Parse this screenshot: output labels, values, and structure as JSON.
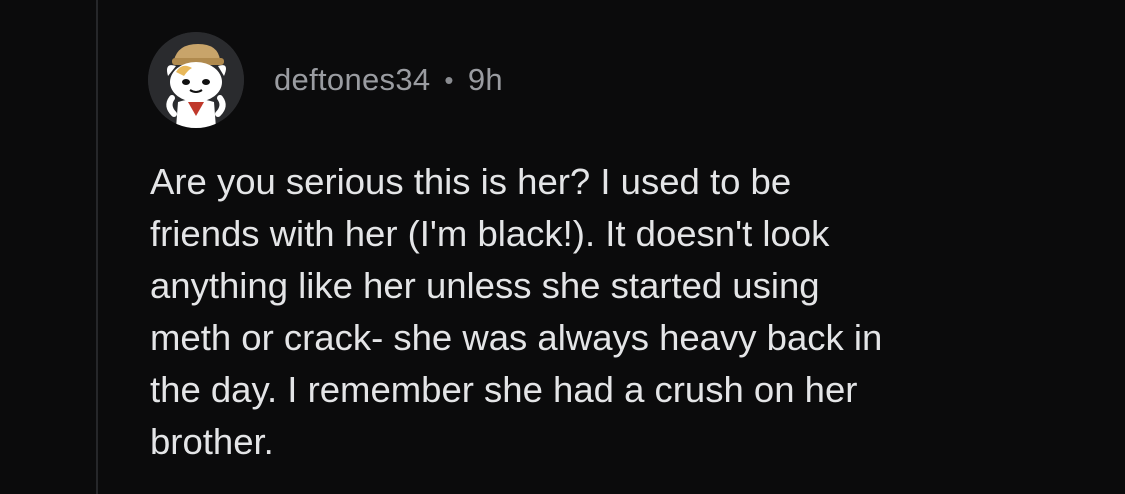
{
  "comment": {
    "username": "deftones34",
    "separator": "•",
    "time": "9h",
    "avatar_icon": "snoo-avatar-icon",
    "body_lines": [
      "Are you serious this is her? I used to be",
      "friends with her (I'm black!). It doesn't look",
      "anything like her unless she started using",
      "meth or crack- she was always heavy back in",
      "the day. I remember she had a crush on her",
      "brother."
    ]
  },
  "colors": {
    "background": "#0b0b0c",
    "thread_line": "#26272a",
    "meta_text": "#9a9ca1",
    "body_text": "#e4e5e7"
  }
}
